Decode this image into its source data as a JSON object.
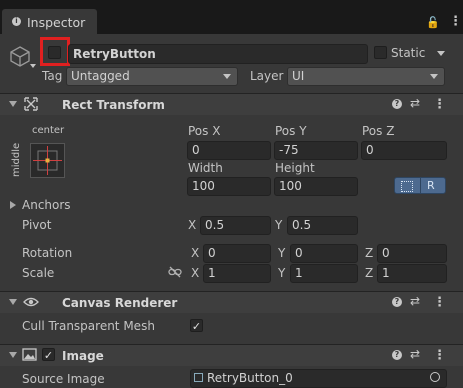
{
  "tab": {
    "title": "Inspector"
  },
  "object": {
    "name": "RetryButton",
    "static_label": "Static",
    "tag_label": "Tag",
    "tag_value": "Untagged",
    "layer_label": "Layer",
    "layer_value": "UI"
  },
  "rect_transform": {
    "title": "Rect Transform",
    "anchor_h": "center",
    "anchor_v": "middle",
    "col_labels": [
      "Pos X",
      "Pos Y",
      "Pos Z"
    ],
    "pos": [
      "0",
      "-75",
      "0"
    ],
    "size_labels": [
      "Width",
      "Height"
    ],
    "size": [
      "100",
      "100"
    ],
    "r_button": "R",
    "anchors_label": "Anchors",
    "pivot_label": "Pivot",
    "pivot": {
      "x_label": "X",
      "x": "0.5",
      "y_label": "Y",
      "y": "0.5"
    },
    "rotation_label": "Rotation",
    "rotation": {
      "x_label": "X",
      "x": "0",
      "y_label": "Y",
      "y": "0",
      "z_label": "Z",
      "z": "0"
    },
    "scale_label": "Scale",
    "scale": {
      "x_label": "X",
      "x": "1",
      "y_label": "Y",
      "y": "1",
      "z_label": "Z",
      "z": "1"
    }
  },
  "canvas_renderer": {
    "title": "Canvas Renderer",
    "cull_label": "Cull Transparent Mesh",
    "cull_checked": true
  },
  "image": {
    "title": "Image",
    "source_label": "Source Image",
    "source_value": "RetryButton_0"
  },
  "colors": {
    "highlight": "#e02020",
    "accent": "#4d6a8f"
  }
}
